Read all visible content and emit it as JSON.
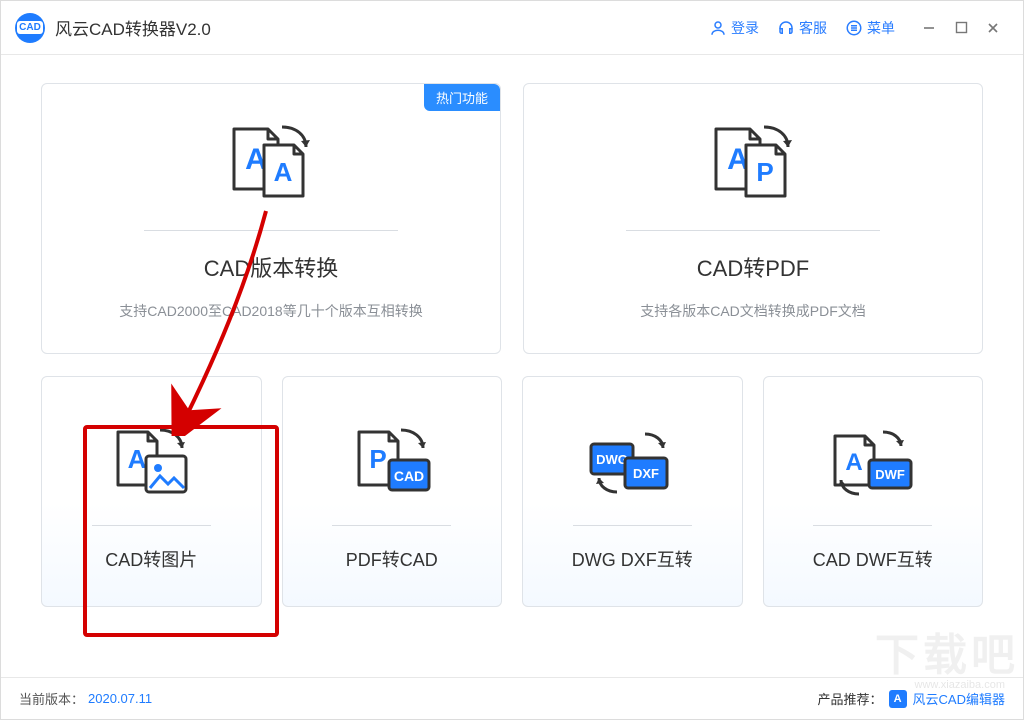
{
  "app": {
    "title": "风云CAD转换器V2.0",
    "logo_text": "CAD"
  },
  "titlebar": {
    "login": "登录",
    "support": "客服",
    "menu": "菜单"
  },
  "cards_top": [
    {
      "title": "CAD版本转换",
      "desc": "支持CAD2000至CAD2018等几十个版本互相转换",
      "badge": "热门功能",
      "icon": "aa-convert"
    },
    {
      "title": "CAD转PDF",
      "desc": "支持各版本CAD文档转换成PDF文档",
      "icon": "ap-convert"
    }
  ],
  "cards_bottom": [
    {
      "title": "CAD转图片",
      "icon": "a-image"
    },
    {
      "title": "PDF转CAD",
      "icon": "p-cad"
    },
    {
      "title": "DWG DXF互转",
      "icon": "dwg-dxf"
    },
    {
      "title": "CAD DWF互转",
      "icon": "a-dwf"
    }
  ],
  "statusbar": {
    "version_label": "当前版本：",
    "version_value": "2020.07.11",
    "recommend_label": "产品推荐：",
    "recommend_badge": "A",
    "recommend_name": "风云CAD编辑器"
  },
  "watermark": {
    "big": "下载吧",
    "small": "www.xiazaiba.com"
  },
  "colors": {
    "accent": "#1f7cff",
    "badge": "#2a8dff",
    "highlight": "#d40000"
  }
}
